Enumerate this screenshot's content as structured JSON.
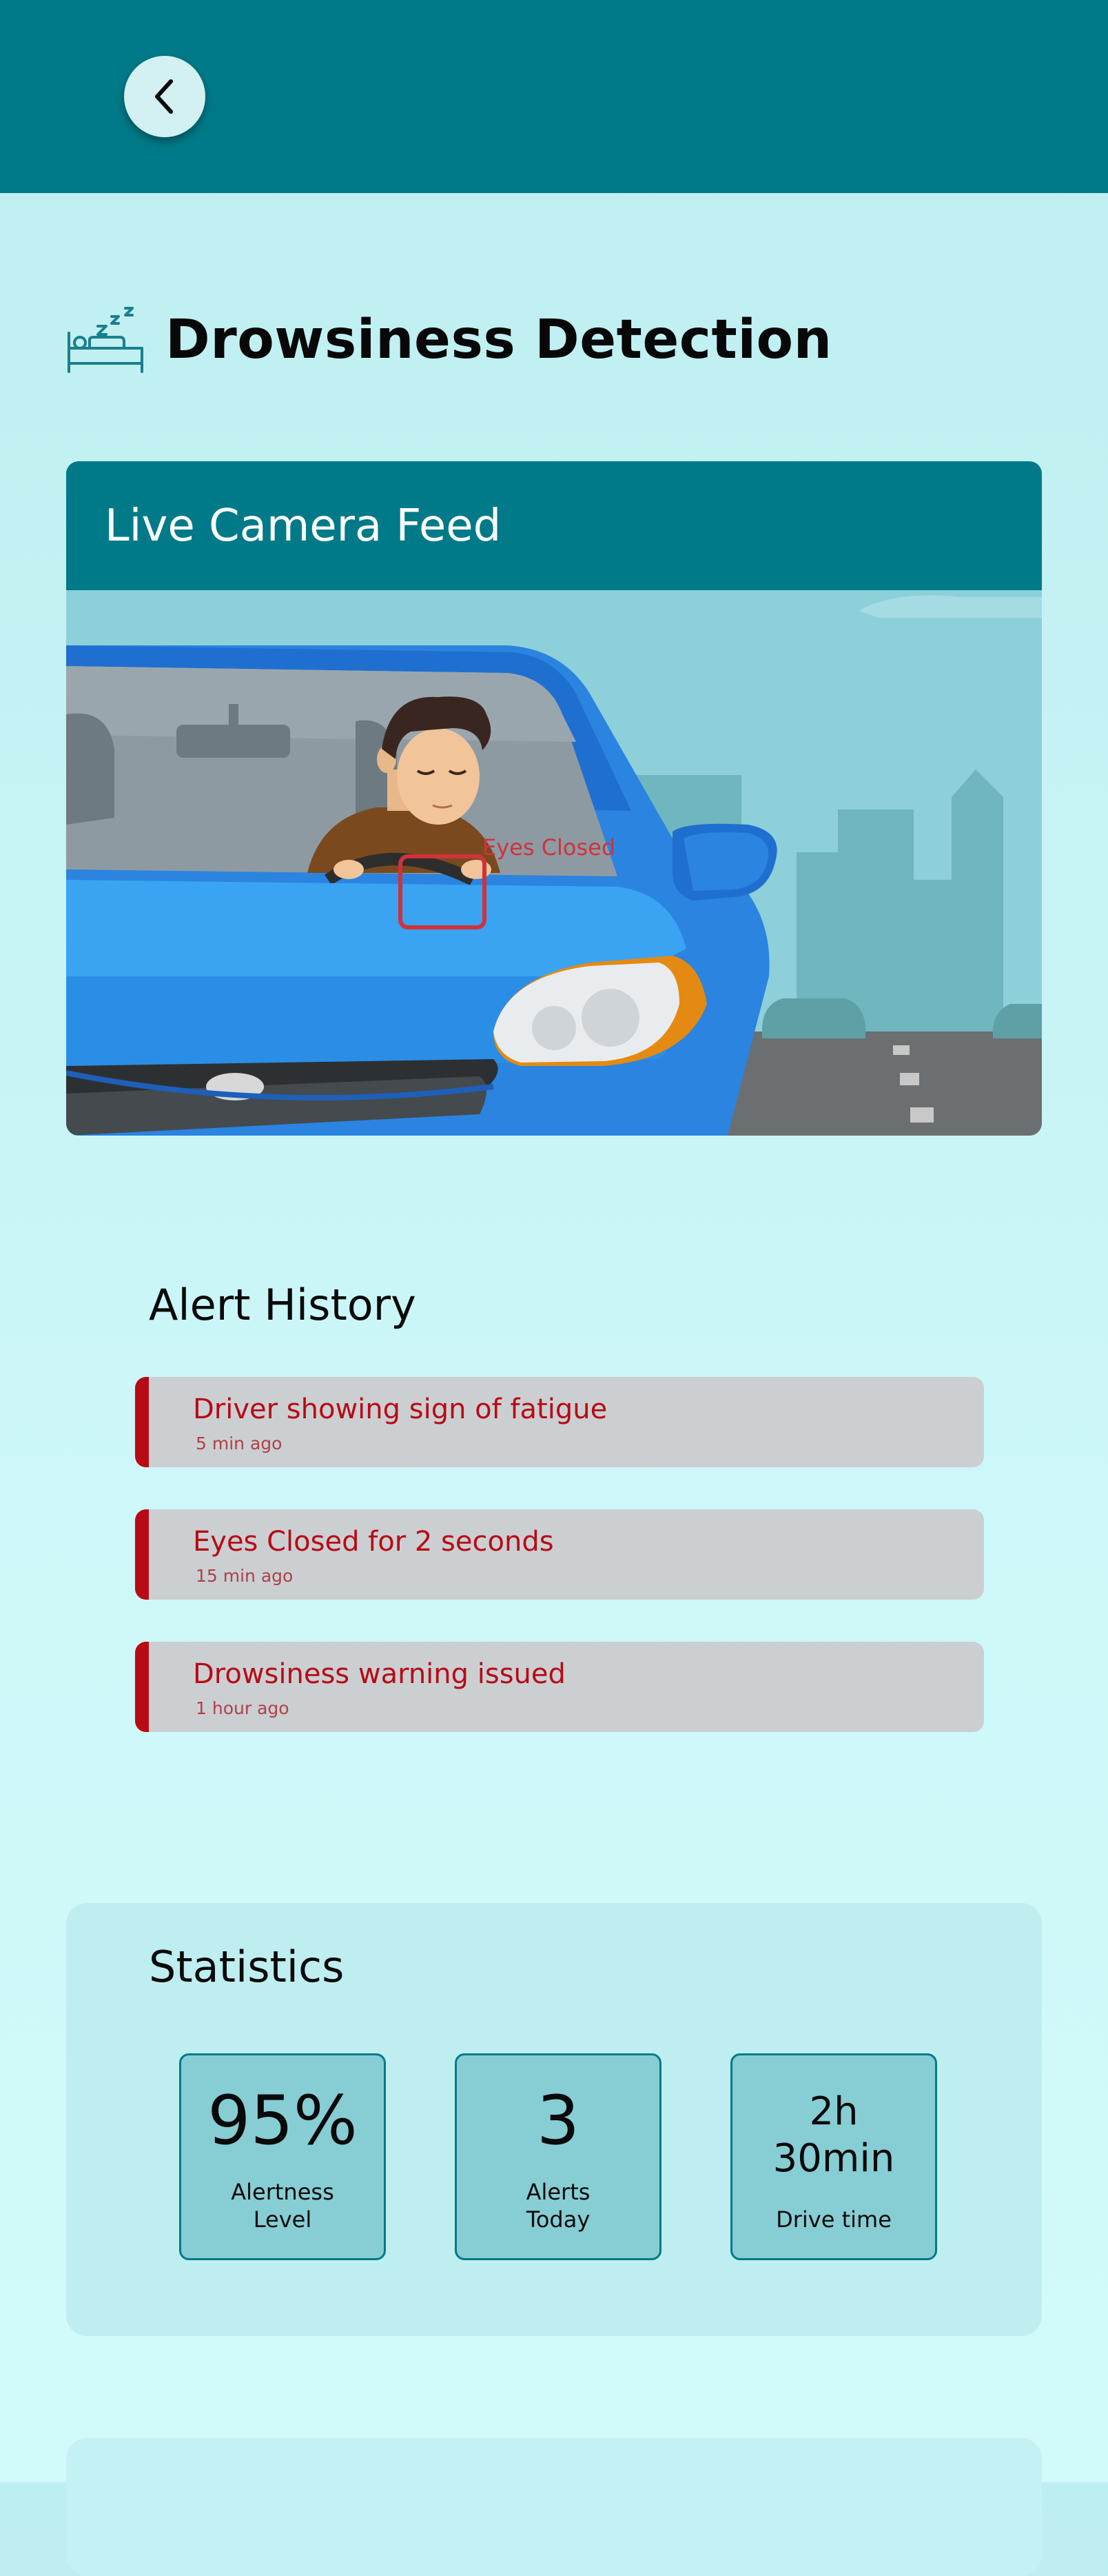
{
  "header": {
    "back_icon": "chevron-left-icon",
    "accent_color": "#007a88"
  },
  "page": {
    "title": "Drowsiness Detection",
    "title_icon": "sleeping-bed-icon"
  },
  "camera": {
    "title": "Live Camera Feed",
    "detection_label": "Eyes Closed"
  },
  "alerts": {
    "title": "Alert History",
    "alert_color": "#b80a14",
    "items": [
      {
        "text": "Driver showing sign of fatigue",
        "time": "5 min ago"
      },
      {
        "text": "Eyes Closed for 2 seconds",
        "time": "15 min ago"
      },
      {
        "text": "Drowsiness warning issued",
        "time": "1 hour ago"
      }
    ]
  },
  "statistics": {
    "title": "Statistics",
    "items": [
      {
        "value": "95%",
        "label": "Alertness Level"
      },
      {
        "value": "3",
        "label": "Alerts Today"
      },
      {
        "value": "2h 30min",
        "label": "Drive time"
      }
    ]
  }
}
